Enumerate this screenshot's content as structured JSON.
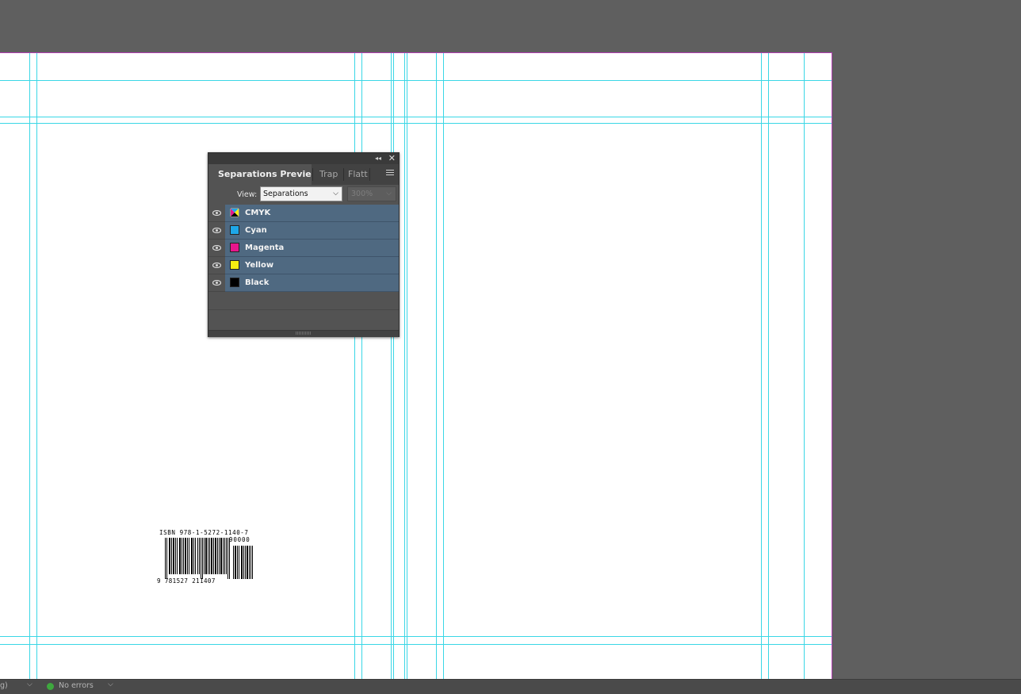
{
  "separations_panel": {
    "tabs": [
      {
        "label": "Separations Preview",
        "active": true
      },
      {
        "label": "Trap",
        "active": false
      },
      {
        "label": "Flatt",
        "active": false
      }
    ],
    "view_label": "View:",
    "view_value": "Separations",
    "zoom_value": "300%",
    "rows": [
      {
        "name": "CMYK",
        "color": "multi",
        "visible": true
      },
      {
        "name": "Cyan",
        "color": "#1ea7e8",
        "visible": true
      },
      {
        "name": "Magenta",
        "color": "#e6168c",
        "visible": true
      },
      {
        "name": "Yellow",
        "color": "#f7ee12",
        "visible": true
      },
      {
        "name": "Black",
        "color": "#000000",
        "visible": true
      }
    ]
  },
  "barcode": {
    "isbn_text": "ISBN 978-1-5272-1140-7",
    "addon_digits": "90000",
    "main_digits": "9 781527 211407"
  },
  "status_bar": {
    "left_text": "g)",
    "preflight_text": "No errors",
    "preflight_color": "#3ea83e"
  },
  "colors": {
    "guide": "#3ad7e6",
    "page_border": "#b13fb1",
    "pasteboard": "#5f5f5f",
    "row_highlight": "#4f6981"
  }
}
